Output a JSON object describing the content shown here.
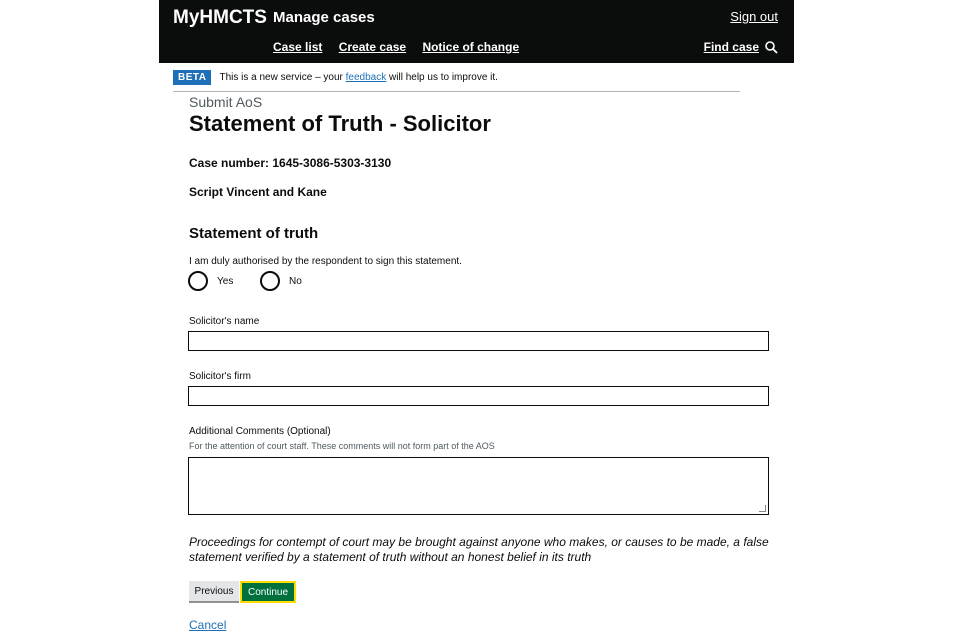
{
  "header": {
    "brand": "MyHMCTS",
    "service": "Manage cases",
    "sign_out": "Sign out",
    "nav": [
      "Case list",
      "Create case",
      "Notice of change"
    ],
    "find_case": "Find case"
  },
  "banner": {
    "tag": "BETA",
    "text_before": "This is a new service – your",
    "link": "feedback",
    "text_after": "will help us to improve it."
  },
  "page": {
    "caption": "Submit AoS",
    "title": "Statement of Truth - Solicitor",
    "case_number": "Case number: 1645-3086-5303-3130",
    "parties": "Script Vincent and Kane",
    "subheading": "Statement of truth"
  },
  "form": {
    "question": "I am duly authorised by the respondent to sign this statement.",
    "options": [
      "Yes",
      "No"
    ],
    "solicitor_name_label": "Solicitor's name",
    "solicitor_name_value": "",
    "solicitor_firm_label": "Solicitor's firm",
    "solicitor_firm_value": "",
    "comments_label": "Additional Comments (Optional)",
    "comments_hint": "For the attention of court staff. These comments will not form part of the AOS",
    "comments_value": ""
  },
  "warning": "Proceedings for contempt of court may be brought against anyone who makes, or causes to be made, a false statement verified by a statement of truth without an honest belief in its truth",
  "buttons": {
    "previous": "Previous",
    "continue": "Continue",
    "cancel": "Cancel"
  },
  "colors": {
    "header_bg": "#0b0c0c",
    "beta_tag": "#1d70b8",
    "continue_bg": "#00703c",
    "focus": "#ffdd00",
    "link": "#1d70b8"
  },
  "icons": {
    "find_case": "search-icon"
  }
}
